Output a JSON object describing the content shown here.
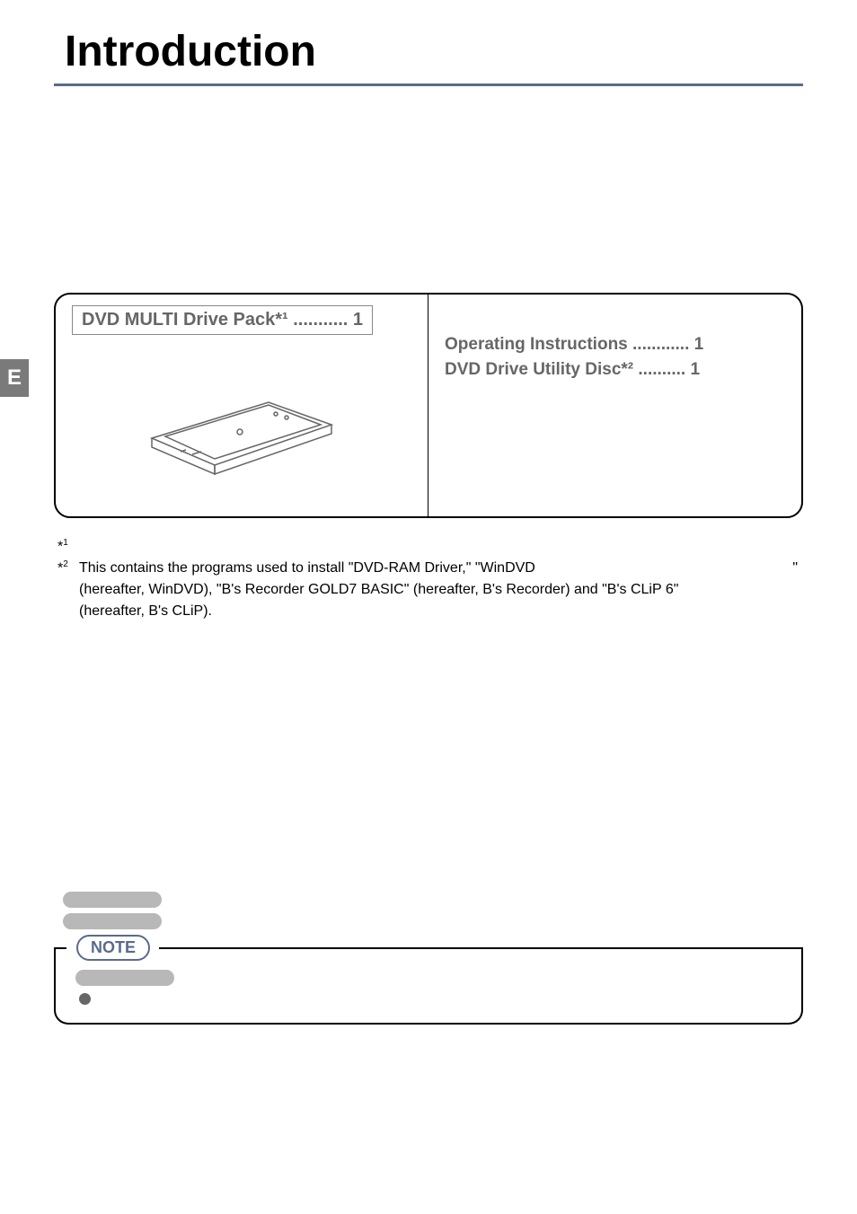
{
  "title": "Introduction",
  "sideTab": "E",
  "contents": {
    "leftTitle": "DVD MULTI Drive Pack*¹ ........... 1",
    "rightItems": [
      "Operating Instructions ............ 1",
      "DVD Drive Utility Disc*² .......... 1"
    ]
  },
  "footnotes": {
    "f1_marker": "*",
    "f1_sup": "1",
    "f2_marker": "*",
    "f2_sup": "2",
    "f2_text_line1": "This contains the programs used to install \"DVD-RAM Driver,\" \"WinDVD",
    "f2_text_quote": "\"",
    "f2_text_line2": "(hereafter, WinDVD), \"B's Recorder GOLD7 BASIC\" (hereafter, B's Recorder) and \"B's CLiP 6\"",
    "f2_text_line3": "(hereafter, B's CLiP)."
  },
  "noteLabel": "NOTE"
}
